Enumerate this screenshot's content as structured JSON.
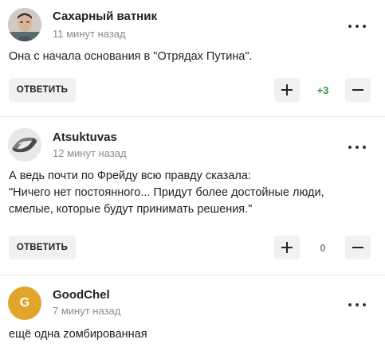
{
  "comments": [
    {
      "author": "Сахарный ватник",
      "time": "11 минут назад",
      "avatar": "photo",
      "text": [
        "Она с начала основания в \"Отрядах Путина\"."
      ],
      "reply_label": "ОТВЕТИТЬ",
      "score": "+3",
      "score_color": "#2e9e3f"
    },
    {
      "author": "Atsuktuvas",
      "time": "12 минут назад",
      "avatar": "chrome-logo",
      "text": [
        "А ведь почти по Фрейду всю правду сказала:",
        "\"Ничего нет постоянного... Придут более достойные люди,",
        "смелые, которые будут принимать решения.\""
      ],
      "reply_label": "ОТВЕТИТЬ",
      "score": "0",
      "score_color": "#8a8a8a"
    },
    {
      "author": "GoodChel",
      "time": "7 минут назад",
      "avatar_letter": "G",
      "avatar_color": "#e0a52a",
      "text": [
        "ещё одна zомбированная"
      ]
    }
  ]
}
